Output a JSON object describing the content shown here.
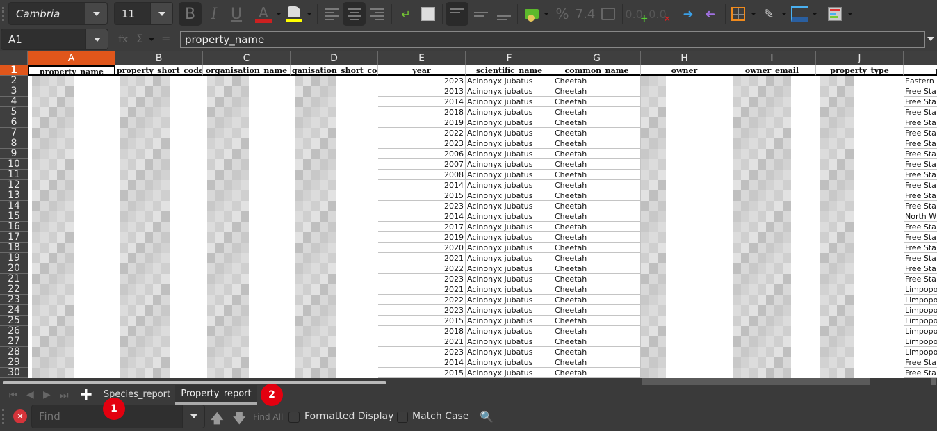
{
  "toolbar": {
    "font_name": "Cambria",
    "font_size": "11",
    "bold_label": "B",
    "italic_label": "I",
    "underline_label": "U",
    "font_color": "#cc2020",
    "highlight_color": "#ffff00",
    "percent_label": "%",
    "number_label": "7.4",
    "add_decimal_label": "0.0",
    "del_decimal_label": "0.0"
  },
  "formula_bar": {
    "name_box": "A1",
    "fx_label": "fx",
    "sigma_label": "Σ",
    "equals_label": "=",
    "content": "property_name"
  },
  "sheet": {
    "columns": [
      "A",
      "B",
      "C",
      "D",
      "E",
      "F",
      "G",
      "H",
      "I",
      "J",
      ""
    ],
    "selected_column": "A",
    "headers": [
      "property_name",
      "property_short_code",
      "organisation_name",
      "organisation_short_code",
      "year",
      "scientific_name",
      "common_name",
      "owner",
      "owner_email",
      "property_type",
      "province"
    ],
    "header_display": [
      "property_name",
      "property_short_code",
      "organisation_name",
      "ganisation_short_co",
      "year",
      "scientific_name",
      "common_name",
      "owner",
      "owner_email",
      "property_type",
      "p"
    ],
    "rows": [
      {
        "n": "2",
        "year": "2023",
        "sci": "Acinonyx jubatus",
        "common": "Cheetah",
        "prov": "Eastern"
      },
      {
        "n": "3",
        "year": "2013",
        "sci": "Acinonyx jubatus",
        "common": "Cheetah",
        "prov": "Free Sta"
      },
      {
        "n": "4",
        "year": "2014",
        "sci": "Acinonyx jubatus",
        "common": "Cheetah",
        "prov": "Free Sta"
      },
      {
        "n": "5",
        "year": "2018",
        "sci": "Acinonyx jubatus",
        "common": "Cheetah",
        "prov": "Free Sta"
      },
      {
        "n": "6",
        "year": "2019",
        "sci": "Acinonyx jubatus",
        "common": "Cheetah",
        "prov": "Free Sta"
      },
      {
        "n": "7",
        "year": "2022",
        "sci": "Acinonyx jubatus",
        "common": "Cheetah",
        "prov": "Free Sta"
      },
      {
        "n": "8",
        "year": "2023",
        "sci": "Acinonyx jubatus",
        "common": "Cheetah",
        "prov": "Free Sta"
      },
      {
        "n": "9",
        "year": "2006",
        "sci": "Acinonyx jubatus",
        "common": "Cheetah",
        "prov": "Free Sta"
      },
      {
        "n": "10",
        "year": "2007",
        "sci": "Acinonyx jubatus",
        "common": "Cheetah",
        "prov": "Free Sta"
      },
      {
        "n": "11",
        "year": "2008",
        "sci": "Acinonyx jubatus",
        "common": "Cheetah",
        "prov": "Free Sta"
      },
      {
        "n": "12",
        "year": "2014",
        "sci": "Acinonyx jubatus",
        "common": "Cheetah",
        "prov": "Free Sta"
      },
      {
        "n": "13",
        "year": "2015",
        "sci": "Acinonyx jubatus",
        "common": "Cheetah",
        "prov": "Free Sta"
      },
      {
        "n": "14",
        "year": "2023",
        "sci": "Acinonyx jubatus",
        "common": "Cheetah",
        "prov": "Free Sta"
      },
      {
        "n": "15",
        "year": "2014",
        "sci": "Acinonyx jubatus",
        "common": "Cheetah",
        "prov": "North W"
      },
      {
        "n": "16",
        "year": "2017",
        "sci": "Acinonyx jubatus",
        "common": "Cheetah",
        "prov": "Free Sta"
      },
      {
        "n": "17",
        "year": "2019",
        "sci": "Acinonyx jubatus",
        "common": "Cheetah",
        "prov": "Free Sta"
      },
      {
        "n": "18",
        "year": "2020",
        "sci": "Acinonyx jubatus",
        "common": "Cheetah",
        "prov": "Free Sta"
      },
      {
        "n": "19",
        "year": "2021",
        "sci": "Acinonyx jubatus",
        "common": "Cheetah",
        "prov": "Free Sta"
      },
      {
        "n": "20",
        "year": "2022",
        "sci": "Acinonyx jubatus",
        "common": "Cheetah",
        "prov": "Free Sta"
      },
      {
        "n": "21",
        "year": "2023",
        "sci": "Acinonyx jubatus",
        "common": "Cheetah",
        "prov": "Free Sta"
      },
      {
        "n": "22",
        "year": "2021",
        "sci": "Acinonyx jubatus",
        "common": "Cheetah",
        "prov": "Limpopo"
      },
      {
        "n": "23",
        "year": "2022",
        "sci": "Acinonyx jubatus",
        "common": "Cheetah",
        "prov": "Limpopo"
      },
      {
        "n": "24",
        "year": "2023",
        "sci": "Acinonyx jubatus",
        "common": "Cheetah",
        "prov": "Limpopo"
      },
      {
        "n": "25",
        "year": "2015",
        "sci": "Acinonyx jubatus",
        "common": "Cheetah",
        "prov": "Limpopo"
      },
      {
        "n": "26",
        "year": "2018",
        "sci": "Acinonyx jubatus",
        "common": "Cheetah",
        "prov": "Limpopo"
      },
      {
        "n": "27",
        "year": "2021",
        "sci": "Acinonyx jubatus",
        "common": "Cheetah",
        "prov": "Limpopo"
      },
      {
        "n": "28",
        "year": "2023",
        "sci": "Acinonyx jubatus",
        "common": "Cheetah",
        "prov": "Limpopo"
      },
      {
        "n": "29",
        "year": "2014",
        "sci": "Acinonyx jubatus",
        "common": "Cheetah",
        "prov": "Free Sta"
      },
      {
        "n": "30",
        "year": "2015",
        "sci": "Acinonyx jubatus",
        "common": "Cheetah",
        "prov": "Free Sta"
      }
    ]
  },
  "tabs": {
    "add_label": "+",
    "items": [
      {
        "label": "Species_report",
        "active": false
      },
      {
        "label": "Property_report",
        "active": true
      }
    ]
  },
  "annotations": [
    {
      "label": "1"
    },
    {
      "label": "2"
    }
  ],
  "findbar": {
    "placeholder": "Find",
    "find_all_label": "Find All",
    "formatted_display_label": "Formatted Display",
    "match_case_label": "Match Case"
  }
}
